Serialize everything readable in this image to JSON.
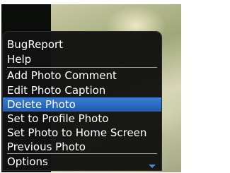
{
  "menu": {
    "items": [
      {
        "label": "BugReport",
        "selected": false
      },
      {
        "label": "Help",
        "selected": false
      },
      {
        "label": "Add Photo Comment",
        "selected": false
      },
      {
        "label": "Edit Photo Caption",
        "selected": false
      },
      {
        "label": "Delete Photo",
        "selected": true
      },
      {
        "label": "Set to Profile Photo",
        "selected": false
      },
      {
        "label": "Set Photo to Home Screen",
        "selected": false
      },
      {
        "label": "Previous Photo",
        "selected": false
      },
      {
        "label": "Options",
        "selected": false
      }
    ],
    "highlight_color": "#2a6ac4",
    "background_color": "#121212"
  },
  "icons": {
    "scroll_indicator": "chevron-down-icon"
  }
}
